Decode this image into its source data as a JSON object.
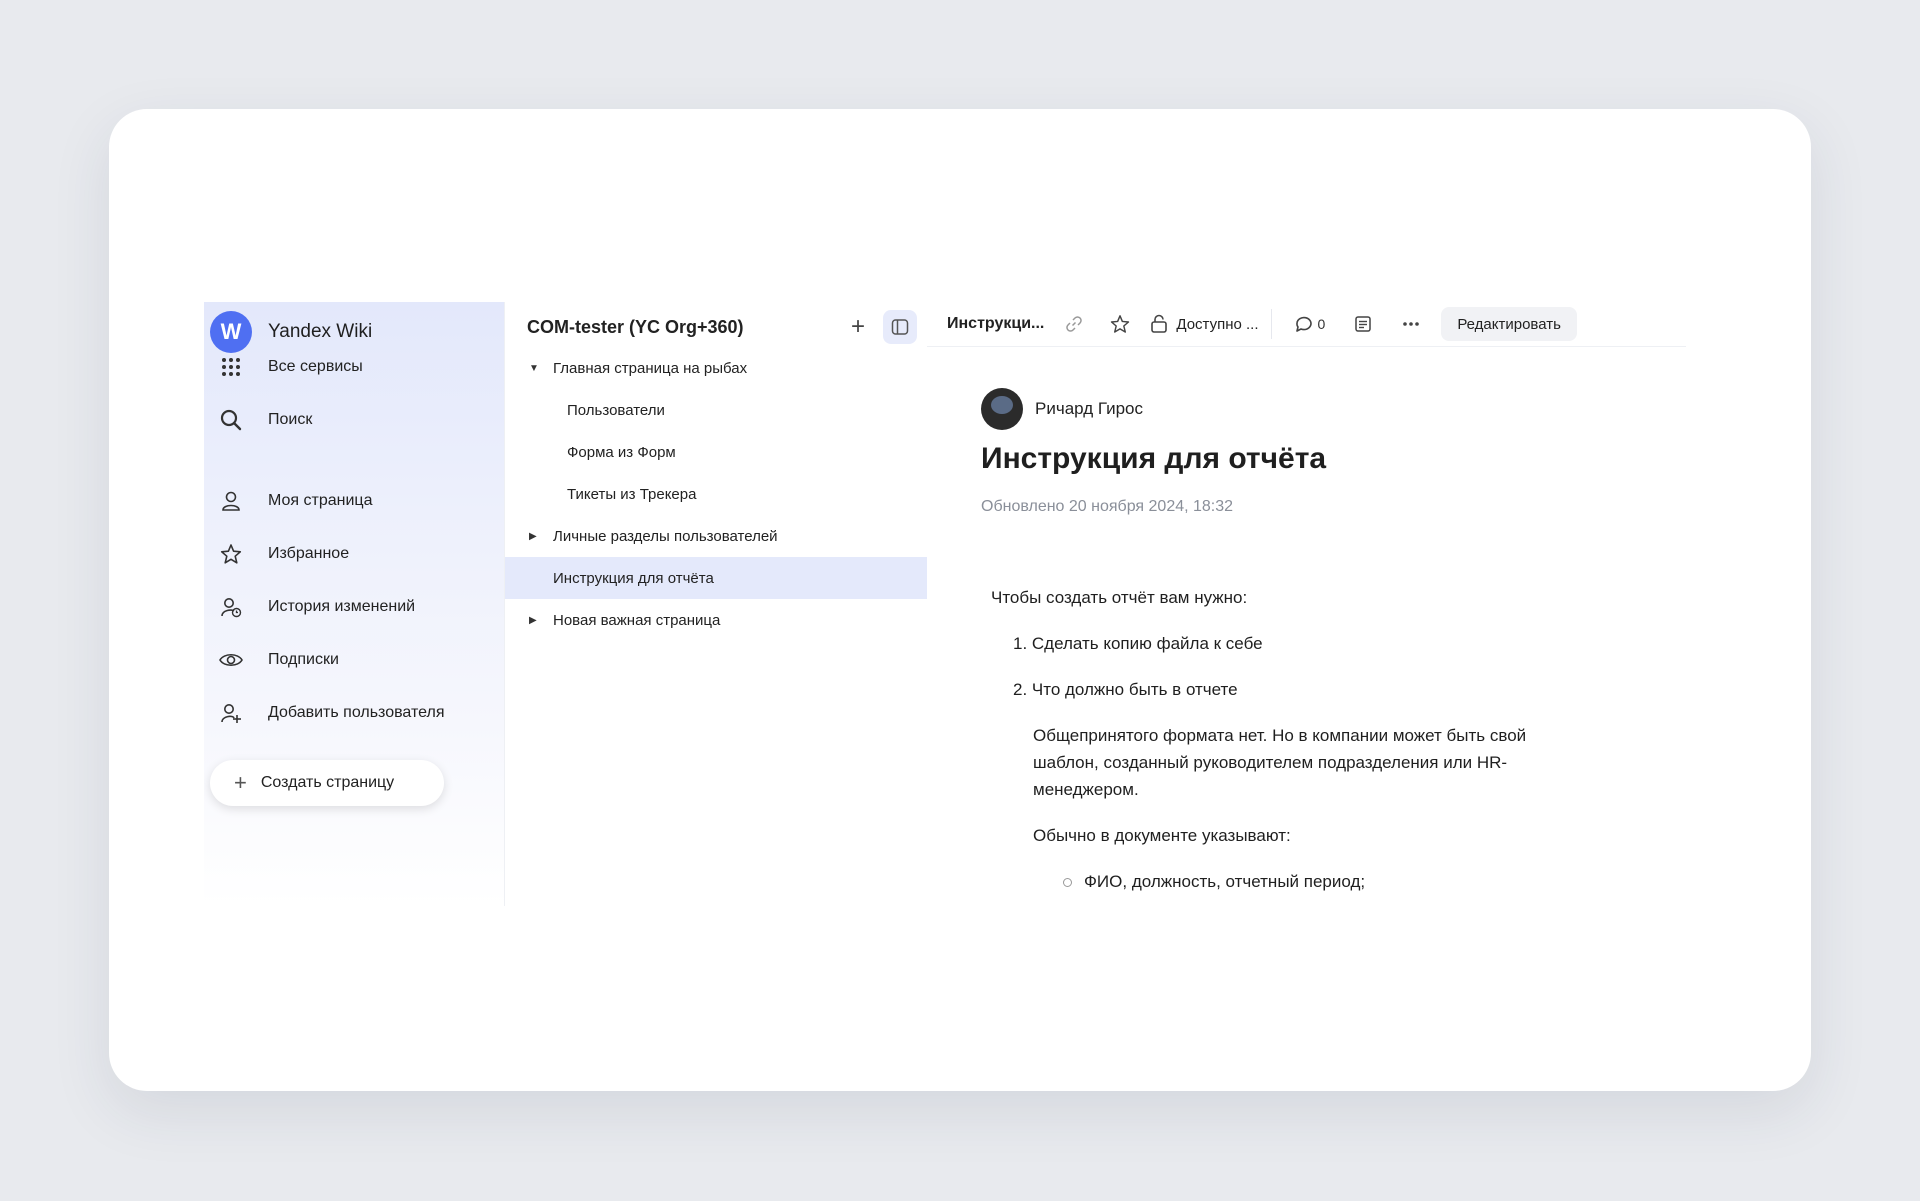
{
  "brand": {
    "logo_letter": "W",
    "name": "Yandex Wiki"
  },
  "sidebar": {
    "items": [
      {
        "label": "Все сервисы",
        "icon": "grid-icon"
      },
      {
        "label": "Поиск",
        "icon": "search-icon"
      },
      {
        "label": "Моя страница",
        "icon": "user-icon"
      },
      {
        "label": "Избранное",
        "icon": "star-icon"
      },
      {
        "label": "История изменений",
        "icon": "user-history-icon"
      },
      {
        "label": "Подписки",
        "icon": "eye-icon"
      },
      {
        "label": "Добавить пользователя",
        "icon": "user-add-icon"
      }
    ],
    "create_label": "Создать страницу"
  },
  "tree": {
    "title": "COM-tester (YC Org+360)",
    "items": [
      {
        "label": "Главная страница на рыбах",
        "caret": "▼"
      },
      {
        "label": "Пользователи"
      },
      {
        "label": "Форма из Форм"
      },
      {
        "label": "Тикеты из Трекера"
      },
      {
        "label": "Личные разделы пользователей",
        "caret": "▶"
      },
      {
        "label": "Инструкция для отчёта",
        "selected": true
      },
      {
        "label": "Новая важная страница",
        "caret": "▶"
      }
    ]
  },
  "toolbar": {
    "crumb": "Инструкци...",
    "access_label": "Доступно ...",
    "comments_count": "0",
    "edit_label": "Редактировать"
  },
  "page": {
    "author": "Ричард Гирос",
    "title": "Инструкция для отчёта",
    "updated": "Обновлено 20 ноября 2024, 18:32",
    "intro": "Чтобы создать отчёт вам нужно:",
    "list": [
      "1. Сделать копию файла к себе",
      "2. Что должно быть в отчете"
    ],
    "para1_line1": "Общепринятого формата нет. Но в компании может быть свой",
    "para1_line2": "шаблон, созданный руководителем подразделения или HR-",
    "para1_line3": "менеджером.",
    "para2": "Обычно в документе указывают:",
    "bullet1": "ФИО, должность, отчетный период;"
  },
  "colors": {
    "accent": "#4f6ff2",
    "selected_bg": "#e4e9fb",
    "muted": "#8a8f99"
  }
}
